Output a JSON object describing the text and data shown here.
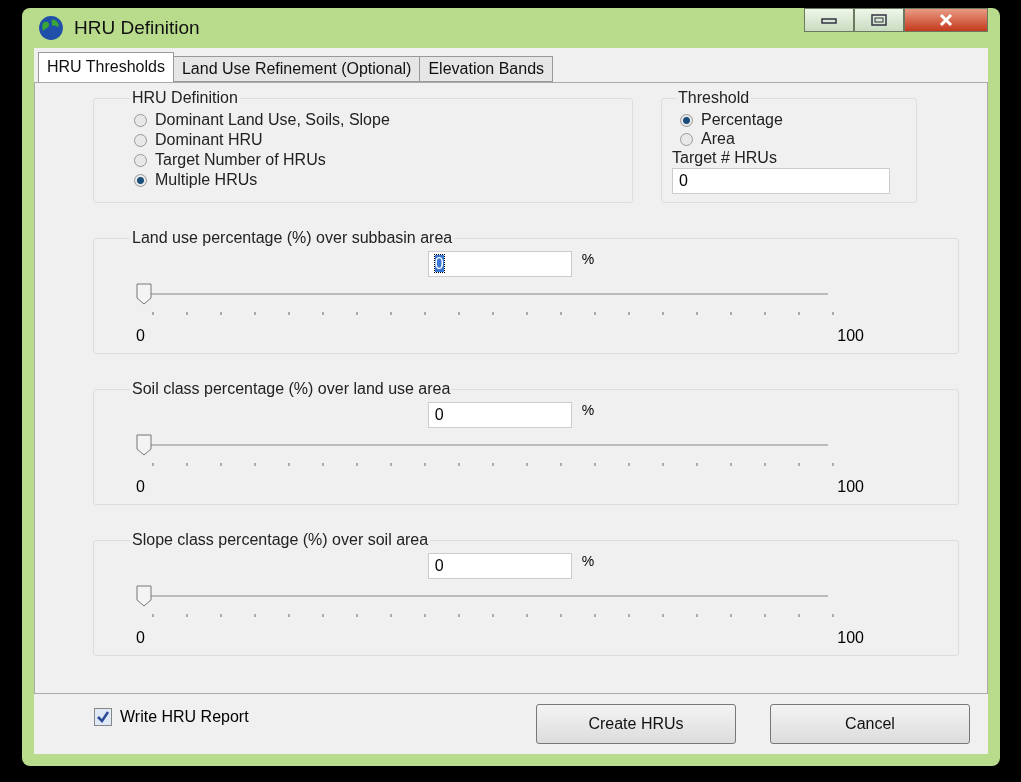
{
  "window": {
    "title": "HRU Definition"
  },
  "tabs": [
    {
      "label": "HRU Thresholds",
      "selected": true
    },
    {
      "label": "Land Use Refinement (Optional)",
      "selected": false
    },
    {
      "label": "Elevation Bands",
      "selected": false
    }
  ],
  "hru_definition": {
    "title": "HRU Definition",
    "options": [
      {
        "label": "Dominant Land Use, Soils, Slope",
        "selected": false
      },
      {
        "label": "Dominant HRU",
        "selected": false
      },
      {
        "label": "Target Number of HRUs",
        "selected": false
      },
      {
        "label": "Multiple HRUs",
        "selected": true
      }
    ]
  },
  "threshold": {
    "title": "Threshold",
    "options": [
      {
        "label": "Percentage",
        "selected": true
      },
      {
        "label": "Area",
        "selected": false
      }
    ],
    "target_label": "Target # HRUs",
    "target_value": "0"
  },
  "sliders": [
    {
      "title": "Land use percentage (%) over subbasin area",
      "value": "0",
      "value_selected": true,
      "unit": "%",
      "level": 0,
      "min_label": "0",
      "max_label": "100"
    },
    {
      "title": "Soil class percentage (%) over land use area",
      "value": "0",
      "value_selected": false,
      "unit": "%",
      "level": 0,
      "min_label": "0",
      "max_label": "100"
    },
    {
      "title": "Slope class percentage (%) over soil area",
      "value": "0",
      "value_selected": false,
      "unit": "%",
      "level": 0,
      "min_label": "0",
      "max_label": "100"
    }
  ],
  "write_report": {
    "label": "Write HRU Report",
    "checked": true
  },
  "buttons": [
    "Create HRUs",
    "Cancel"
  ]
}
